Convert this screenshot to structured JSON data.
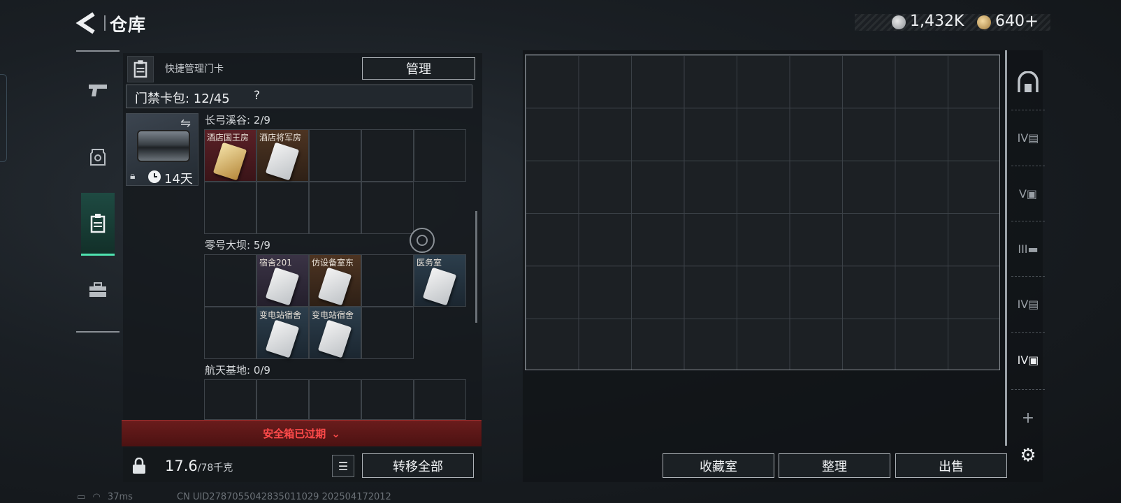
{
  "header": {
    "title": "仓库",
    "currency_silver": "1,432K",
    "currency_gold": "640",
    "plus_symbol": "+"
  },
  "left_nav": {
    "items": [
      {
        "name": "weapon",
        "icon": "pistol-icon"
      },
      {
        "name": "gear",
        "icon": "armor-icon"
      },
      {
        "name": "keycard",
        "icon": "keycard-icon",
        "active": true
      },
      {
        "name": "toolbox",
        "icon": "briefcase-icon"
      }
    ]
  },
  "card_manager": {
    "quick_label": "快捷管理门卡",
    "manage_label": "管理",
    "cardpack_label": "门禁卡包: 12/45",
    "help": "?",
    "holder_days": "14天"
  },
  "sections": [
    {
      "label": "长弓溪谷: 2/9",
      "cards": [
        {
          "name": "酒店国王房",
          "color": "red"
        },
        {
          "name": "酒店将军房",
          "color": "orange"
        }
      ]
    },
    {
      "label": "零号大坝: 5/9",
      "cards": [
        {
          "name": "宿舍201",
          "color": "purple"
        },
        {
          "name": "仿设备室东",
          "color": "orange"
        },
        {
          "name": "医务室",
          "color": "blue"
        },
        {
          "name": "变电站宿舍",
          "color": "blue"
        },
        {
          "name": "变电站宿舍",
          "color": "blue"
        }
      ]
    },
    {
      "label": "航天基地: 0/9",
      "cards": []
    }
  ],
  "warning": "安全箱已过期",
  "footer": {
    "weight_value": "17.6",
    "weight_max": "/78千克",
    "transfer_all": "转移全部"
  },
  "right_actions": {
    "collection": "收藏室",
    "organize": "整理",
    "sell": "出售"
  },
  "right_tabs": [
    "home-tab-icon",
    "case-iv-icon",
    "case-v-icon",
    "case-iii-icon",
    "case-iv2-icon",
    "case-iv3-icon",
    "add-icon",
    "settings-icon"
  ],
  "status": {
    "ping": "37ms",
    "uid": "CN UID2787055042835011029 202504172012"
  },
  "colors": {
    "accent": "#4fe3b0",
    "warning": "#ff4a4a"
  }
}
